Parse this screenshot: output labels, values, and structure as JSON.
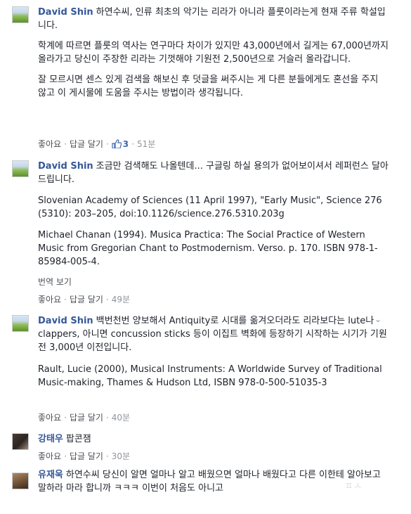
{
  "comments": [
    {
      "author": "David Shin",
      "paragraphs": [
        "하연수씨, 인류 최초의 악기는 리라가 아니라 플룻이라는게 현재 주류 학설입니다.",
        "학계에 따르면 플룻의 역사는 연구마다 차이가 있지만 43,000년에서 길게는 67,000년까지 올라가고 당신이 주장한 리라는 기껏해야 기원전 2,500년으로 거슬러 올라갑니다.",
        "잘 모르시면 센스 있게 검색을 해보신 후 덧글을 써주시는 게 다른 분들에게도 혼선을 주지 않고 이 게시물에 도움을 주시는 방법이라 생각됩니다."
      ],
      "like": "좋아요",
      "reply": "답글 달기",
      "reaction_count": "3",
      "time": "51분"
    },
    {
      "author": "David Shin",
      "paragraphs": [
        "조금만 검색해도 나올텐데... 구글링 하실 용의가 없어보이셔서 레퍼런스 달아드립니다.",
        "Slovenian Academy of Sciences (11 April 1997), \"Early Music\", Science 276 (5310): 203–205, doi:10.1126/science.276.5310.203g",
        "Michael Chanan (1994). Musica Practica: The Social Practice of Western Music from Gregorian Chant to Postmodernism. Verso. p. 170. ISBN 978-1-85984-005-4."
      ],
      "translate": "번역 보기",
      "like": "좋아요",
      "reply": "답글 달기",
      "time": "49분"
    },
    {
      "author": "David Shin",
      "paragraphs": [
        "백번천번 양보해서 Antiquity로 시대를 옮겨오더라도 리라보다는 lute나 clappers, 아니면 concussion sticks 등이 이집트 벽화에 등장하기 시작하는 시기가 기원전 3,000년 이전입니다.",
        "Rault, Lucie (2000), Musical Instruments: A Worldwide Survey of Traditional Music-making, Thames & Hudson Ltd, ISBN 978-0-500-51035-3"
      ],
      "like": "좋아요",
      "reply": "답글 달기",
      "time": "40분"
    },
    {
      "author": "강태우",
      "paragraphs": [
        "팝콘잼"
      ],
      "like": "좋아요",
      "reply": "답글 달기",
      "time": "30분"
    },
    {
      "author": "유재욱",
      "paragraphs": [
        "하연수씨 당신이 알면 얼마나 알고 배웠으면 얼마나 배웠다고 다른 이한테 알아보고 말하라 마라 합니까 ㅋㅋㅋ 이번이 처음도 아니고"
      ]
    }
  ],
  "options_chevron": "⌄",
  "icons": {
    "thumbs_up": "thumbs-up-icon",
    "options": "chevron-down-icon"
  },
  "colors": {
    "author": "#365899",
    "meta": "#90949c",
    "link": "#4b4f56",
    "like_badge": "#4267b2"
  },
  "watermark": "ㅍㅅ"
}
